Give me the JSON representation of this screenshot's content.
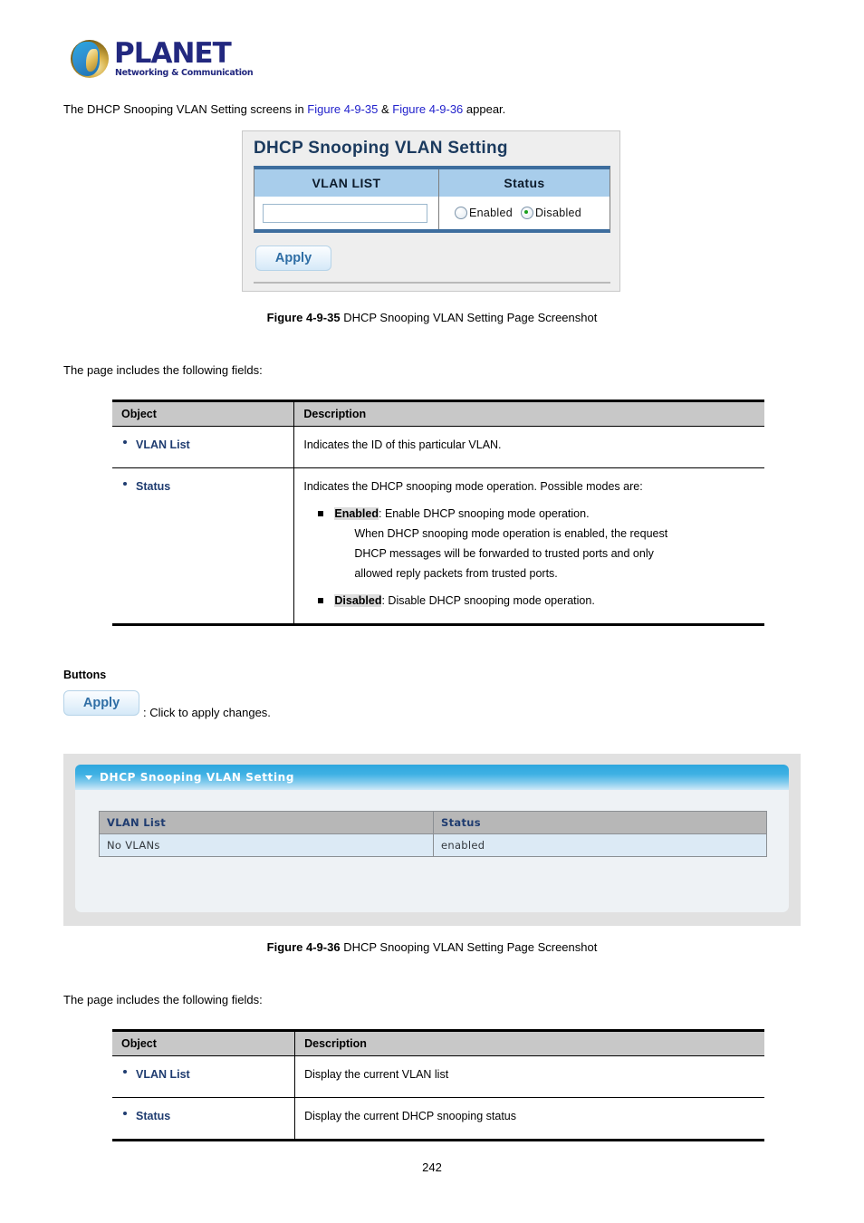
{
  "logo": {
    "wordmark": "PLANET",
    "tagline": "Networking & Communication"
  },
  "intro": {
    "before": "The DHCP Snooping VLAN Setting screens in ",
    "ref1": "Figure 4-9-35",
    "amp": " & ",
    "ref2": "Figure 4-9-36",
    "after": " appear."
  },
  "screenshot1": {
    "title": "DHCP Snooping VLAN Setting",
    "columns": [
      "VLAN LIST",
      "Status"
    ],
    "vlan_input_value": "",
    "vlan_input_placeholder": "",
    "radio_enabled_label": "Enabled",
    "radio_disabled_label": "Disabled",
    "selected_status": "Disabled",
    "apply_label": "Apply"
  },
  "figure1_caption": {
    "label": "Figure 4-9-35",
    "text": " DHCP Snooping VLAN Setting Page Screenshot"
  },
  "fields_note_1": "The page includes the following fields:",
  "table1": {
    "headers": [
      "Object",
      "Description"
    ],
    "rows": [
      {
        "object": "VLAN List",
        "description": "Indicates the ID of this particular VLAN."
      },
      {
        "object": "Status",
        "description": "Indicates the DHCP snooping mode operation. Possible modes are:",
        "bullets": [
          {
            "term": "Enabled",
            "rest": ": Enable DHCP snooping mode operation.",
            "lines": [
              "When DHCP snooping mode operation is enabled, the request",
              "DHCP messages will be forwarded to trusted ports and only",
              "allowed reply packets from trusted ports."
            ]
          },
          {
            "term": "Disabled",
            "rest": ": Disable DHCP snooping mode operation.",
            "lines": []
          }
        ]
      }
    ]
  },
  "buttons_section": {
    "heading": "Buttons",
    "apply_label": "Apply",
    "apply_note": ": Click to apply changes."
  },
  "screenshot2": {
    "header_title": "DHCP Snooping VLAN Setting",
    "columns": [
      "VLAN List",
      "Status"
    ],
    "rows": [
      {
        "vlan_list": "No VLANs",
        "status": "enabled"
      }
    ]
  },
  "figure2_caption": {
    "label": "Figure 4-9-36",
    "text": " DHCP Snooping VLAN Setting Page Screenshot"
  },
  "fields_note_2": "The page includes the following fields:",
  "table2": {
    "headers": [
      "Object",
      "Description"
    ],
    "rows": [
      {
        "object": "VLAN List",
        "description": "Display the current VLAN list"
      },
      {
        "object": "Status",
        "description": "Display the current DHCP snooping status"
      }
    ]
  },
  "page_number": "242",
  "colors": {
    "brand_navy": "#22287f",
    "link_blue": "#2222cc",
    "panel_header_blue": "#a8cdeb",
    "panel_border_navy": "#3d6d9e",
    "radio_on_green": "#19a01c",
    "table_header_gray": "#c8c8c8",
    "object_text_blue": "#1f3c70",
    "web_header_blue": "#2ea6dd",
    "web_row_blue": "#dceaf5"
  }
}
